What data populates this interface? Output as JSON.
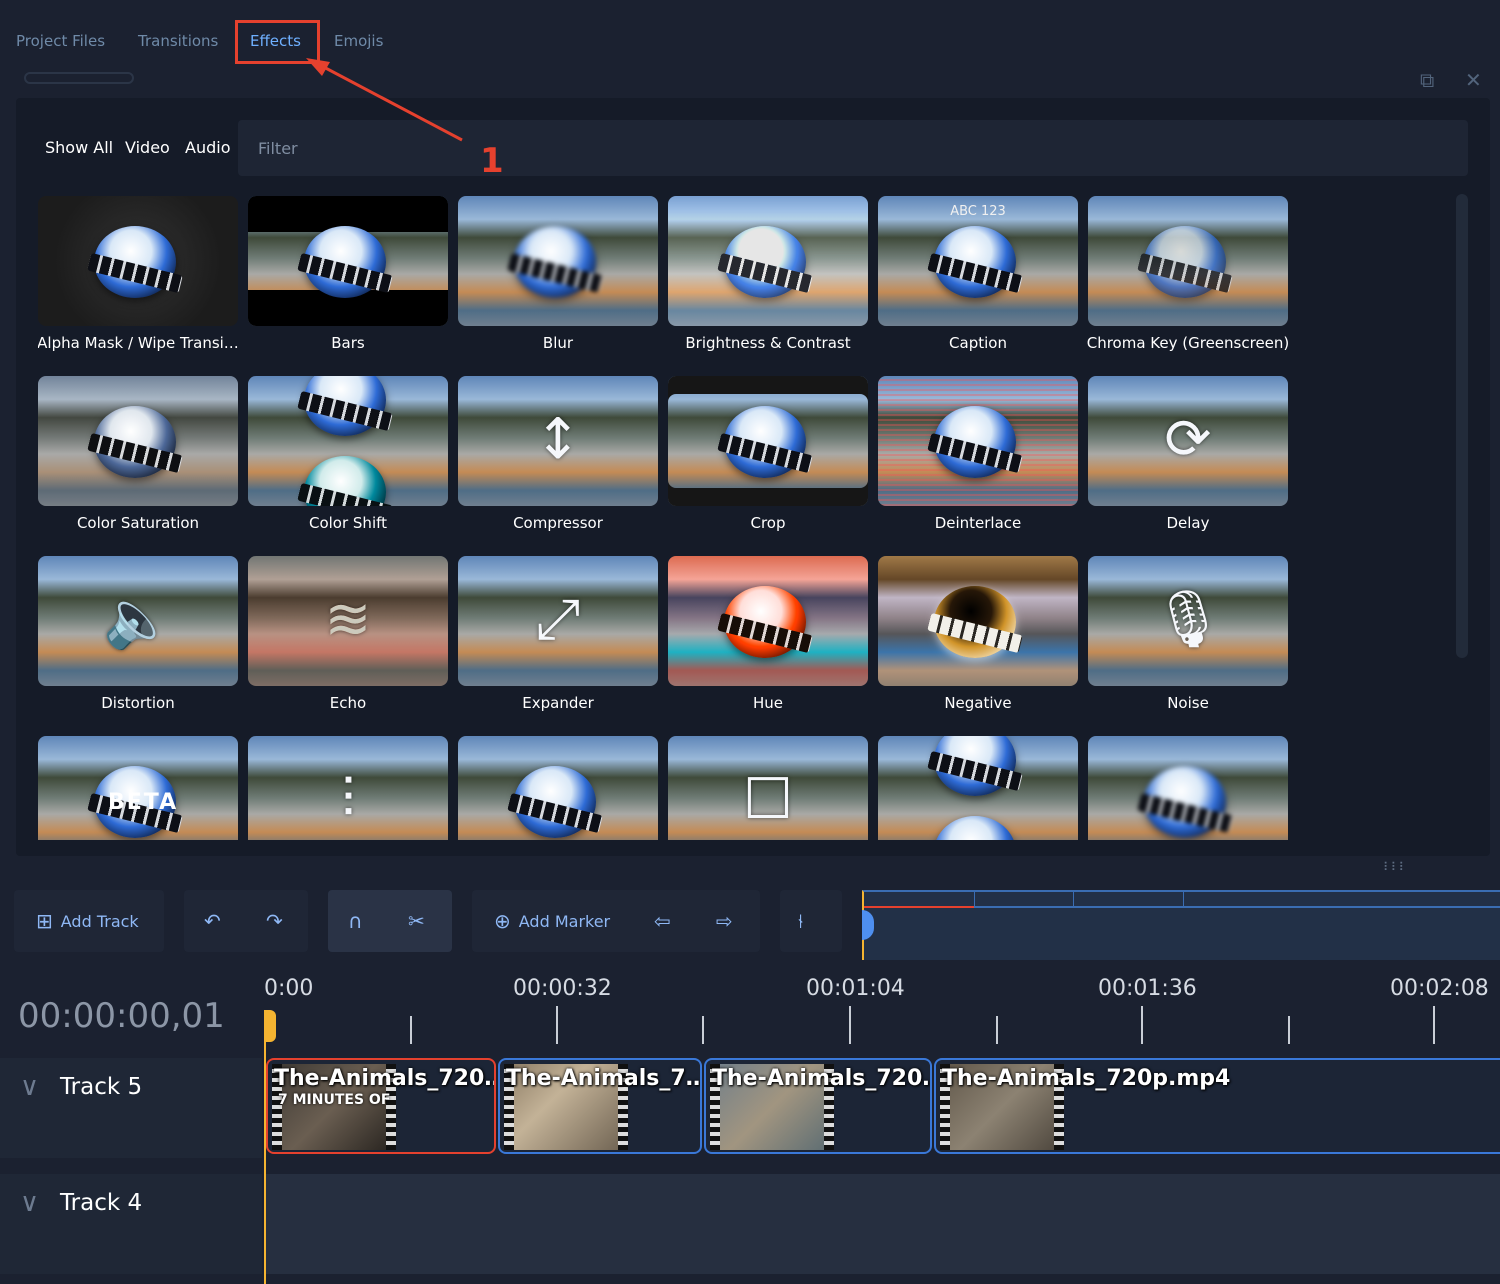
{
  "tabs": [
    "Project Files",
    "Transitions",
    "Effects",
    "Emojis"
  ],
  "active_tab": "Effects",
  "annotation": {
    "number": "1",
    "color": "#e5412e"
  },
  "window_icons": {
    "restore": "restore-icon",
    "close": "close-icon"
  },
  "filters": {
    "show_all": "Show All",
    "video": "Video",
    "audio": "Audio",
    "placeholder": "Filter"
  },
  "effects": [
    "Alpha Mask / Wipe Transi…",
    "Bars",
    "Blur",
    "Brightness & Contrast",
    "Caption",
    "Chroma Key (Greenscreen)",
    "Color Saturation",
    "Color Shift",
    "Compressor",
    "Crop",
    "Deinterlace",
    "Delay",
    "Distortion",
    "Echo",
    "Expander",
    "Hue",
    "Negative",
    "Noise"
  ],
  "effect_extras": {
    "caption_text": "ABC 123",
    "beta_text": "BETA"
  },
  "toolbar": {
    "add_track": "Add Track",
    "add_marker": "Add Marker",
    "icons": [
      "add-track-icon",
      "undo-icon",
      "redo-icon",
      "snap-icon",
      "razor-icon",
      "add-marker-icon",
      "previous-marker-icon",
      "next-marker-icon",
      "center-playhead-icon"
    ]
  },
  "timeline": {
    "timecode": "00:00:00,01",
    "ruler_labels": [
      "0:00",
      "00:00:32",
      "00:01:04",
      "00:01:36",
      "00:02:08"
    ],
    "tracks": [
      {
        "name": "Track 5",
        "clips": [
          {
            "title": "The-Animals_720…",
            "caption": "7 MINUTES OF",
            "selected": true
          },
          {
            "title": "The-Animals_7…"
          },
          {
            "title": "The-Animals_720…"
          },
          {
            "title": "The-Animals_720p.mp4"
          }
        ]
      },
      {
        "name": "Track 4",
        "clips": []
      }
    ]
  },
  "colors": {
    "accent": "#6fb0ff",
    "selection": "#e5412e",
    "playhead": "#f5b431",
    "clip_border": "#3a78d8"
  }
}
